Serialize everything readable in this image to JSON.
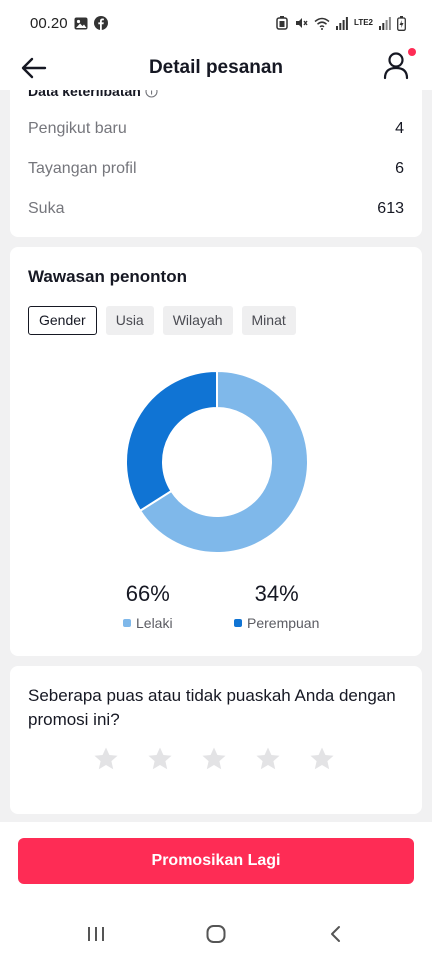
{
  "status_bar": {
    "time": "00.20",
    "network": "LTE2"
  },
  "header": {
    "title": "Detail pesanan"
  },
  "engagement": {
    "title": "Data keterlibatan",
    "metrics": [
      {
        "label": "Pengikut baru",
        "value": "4"
      },
      {
        "label": "Tayangan profil",
        "value": "6"
      },
      {
        "label": "Suka",
        "value": "613"
      }
    ]
  },
  "audience": {
    "title": "Wawasan penonton",
    "tabs": [
      {
        "label": "Gender",
        "active": true
      },
      {
        "label": "Usia",
        "active": false
      },
      {
        "label": "Wilayah",
        "active": false
      },
      {
        "label": "Minat",
        "active": false
      }
    ],
    "chart_data": {
      "type": "pie",
      "categories": [
        "Lelaki",
        "Perempuan"
      ],
      "values": [
        66,
        34
      ],
      "colors": [
        "#7fb8ea",
        "#1074d4"
      ],
      "labels": [
        "66%",
        "34%"
      ]
    }
  },
  "rating": {
    "question": "Seberapa puas atau tidak puaskah Anda dengan promosi ini?",
    "max_stars": 5,
    "selected": 0
  },
  "cta": {
    "label": "Promosikan Lagi"
  },
  "colors": {
    "accent": "#fe2c55",
    "male": "#7fb8ea",
    "female": "#1074d4",
    "star_empty": "#e3e3e5"
  }
}
